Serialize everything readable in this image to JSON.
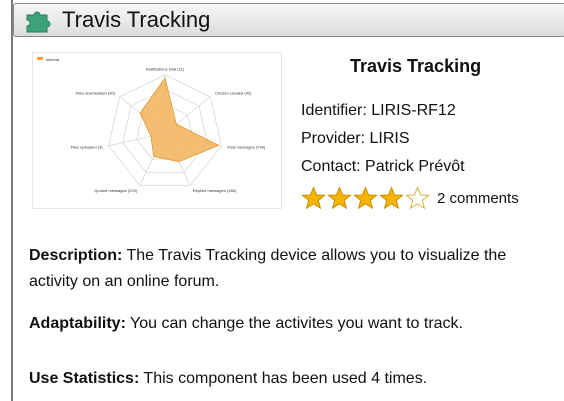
{
  "widget": {
    "title": "Travis Tracking",
    "icon": "puzzle-piece-icon"
  },
  "thumbnail": {
    "legend": "Interval",
    "axis_labels": [
      "Notifications total (11)",
      "Chosen created (42)",
      "Post messages (799)",
      "Replied messages (186)",
      "Quoted messages (229)",
      "Files uploaded (3)",
      "Files downloaded (90)"
    ]
  },
  "component": {
    "name": "Travis Tracking",
    "identifier": "Identifier: LIRIS-RF12",
    "provider": "Provider: LIRIS",
    "contact": "Contact: Patrick Prévôt",
    "rating": 4,
    "rating_max": 5,
    "comments": "2 comments"
  },
  "description": {
    "label": "Description:",
    "text": " The Travis Tracking device allows you to visualize the activity on an online forum."
  },
  "adaptability": {
    "label": "Adaptability:",
    "text": " You can change the activites you want to track."
  },
  "statistics": {
    "label": "Use Statistics:",
    "text": " This component has been used 4 times."
  },
  "colors": {
    "star_fill": "#f5b500",
    "radar_fill": "#f2b25c"
  }
}
